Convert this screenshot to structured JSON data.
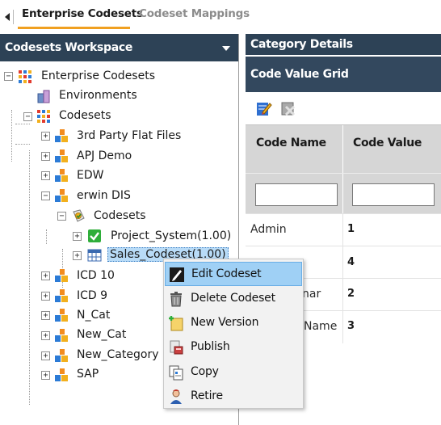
{
  "tabs": [
    {
      "label": "Enterprise Codesets",
      "active": true
    },
    {
      "label": "Codeset Mappings",
      "active": false
    }
  ],
  "workspace": {
    "title": "Codesets Workspace",
    "tree": [
      {
        "label": "Enterprise Codesets",
        "icon": "enterprise-grid-icon",
        "expander": "−"
      },
      {
        "label": "Environments",
        "icon": "environments-icon"
      },
      {
        "label": "Codesets",
        "icon": "codesets-grid-icon",
        "expander": "−"
      },
      {
        "label": "3rd Party Flat Files",
        "icon": "codeset-group-icon",
        "expander": "+"
      },
      {
        "label": "APJ Demo",
        "icon": "codeset-group-icon",
        "expander": "+"
      },
      {
        "label": "EDW",
        "icon": "codeset-group-icon",
        "expander": "+"
      },
      {
        "label": "erwin DIS",
        "icon": "codeset-group-icon",
        "expander": "−"
      },
      {
        "label": "Codesets",
        "icon": "codesets-folder-icon",
        "expander": "−"
      },
      {
        "label": "Project_System(1.00)",
        "icon": "check-codeset-icon",
        "expander": "+"
      },
      {
        "label": "Sales_Codeset(1.00)",
        "icon": "table-codeset-icon",
        "expander": "+",
        "selected": true
      },
      {
        "label": "ICD 10",
        "icon": "codeset-group-icon",
        "expander": "+"
      },
      {
        "label": "ICD 9",
        "icon": "codeset-group-icon",
        "expander": "+"
      },
      {
        "label": "N_Cat",
        "icon": "codeset-group-icon",
        "expander": "+"
      },
      {
        "label": "New_Cat",
        "icon": "codeset-group-icon",
        "expander": "+"
      },
      {
        "label": "New_Category",
        "icon": "codeset-group-icon",
        "expander": "+"
      },
      {
        "label": "SAP",
        "icon": "codeset-group-icon",
        "expander": "+"
      }
    ]
  },
  "details": {
    "category_title": "Category Details",
    "grid_title": "Code Value Grid",
    "columns": [
      "Code Name",
      "Code Value"
    ],
    "rows": [
      {
        "name": "Admin",
        "value": "1"
      },
      {
        "name": "",
        "value": "4"
      },
      {
        "name": "nar",
        "value": "2"
      },
      {
        "name": "Name",
        "value": "3"
      }
    ]
  },
  "context_menu": [
    {
      "label": "Edit Codeset",
      "icon": "edit-icon",
      "highlighted": true
    },
    {
      "label": "Delete Codeset",
      "icon": "trash-icon"
    },
    {
      "label": "New Version",
      "icon": "new-version-icon"
    },
    {
      "label": "Publish",
      "icon": "publish-icon"
    },
    {
      "label": "Copy",
      "icon": "copy-icon"
    },
    {
      "label": "Retire",
      "icon": "retire-icon"
    }
  ],
  "colors": {
    "header_bg": "#2d4256",
    "tab_accent": "#f0a020",
    "selection": "#b8dbf7",
    "menu_highlight": "#9fd0f5"
  }
}
